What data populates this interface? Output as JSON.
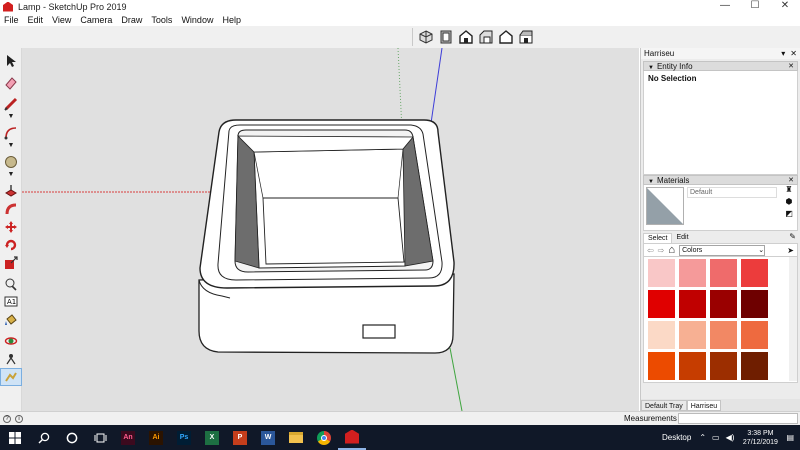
{
  "window": {
    "title": "Lamp - SketchUp Pro 2019",
    "controls": [
      "—",
      "☐",
      "✕"
    ]
  },
  "menu": [
    "File",
    "Edit",
    "View",
    "Camera",
    "Draw",
    "Tools",
    "Window",
    "Help"
  ],
  "view_toolbar": [
    "iso-view",
    "top-view",
    "front-view",
    "right-view",
    "back-view",
    "left-view"
  ],
  "left_tools": [
    "select",
    "eraser",
    "line",
    "arc",
    "circle",
    "push-pull",
    "follow-me",
    "move",
    "rotate",
    "scale",
    "tape-measure",
    "text",
    "paint-bucket",
    "orbit",
    "walk"
  ],
  "tray": {
    "title": "Harriseu",
    "controls": [
      "▾",
      "✕"
    ],
    "entity_info": {
      "header": "Entity Info",
      "value": "No Selection"
    },
    "materials": {
      "header": "Materials",
      "current_name": "Default",
      "tabs": [
        "Select",
        "Edit"
      ],
      "active_tab": "Select",
      "library": "Colors",
      "swatches": [
        "#f9c7c7",
        "#f59a9a",
        "#ef6b6b",
        "#ec3c3c",
        "#e00000",
        "#c00000",
        "#9a0000",
        "#6e0000",
        "#fbd9c6",
        "#f7b093",
        "#f28864",
        "#ee6a3f",
        "#ec4b00",
        "#c63d00",
        "#9c2e00",
        "#6f1e00",
        "#fde3c9",
        "#f9c49a",
        "#f5a66c",
        "#f08a44"
      ]
    },
    "bottom_tabs": [
      "Default Tray",
      "Harriseu"
    ],
    "active_bottom_tab": "Harriseu"
  },
  "status": {
    "measurements_label": "Measurements",
    "measurements_value": ""
  },
  "taskbar": {
    "apps": [
      {
        "name": "animate",
        "label": "An",
        "color": "#3c0a1e",
        "fg": "#ff5c8d"
      },
      {
        "name": "illustrator",
        "label": "Ai",
        "color": "#2b1300",
        "fg": "#ff9a00"
      },
      {
        "name": "photoshop",
        "label": "Ps",
        "color": "#001d34",
        "fg": "#31a8ff"
      },
      {
        "name": "excel",
        "label": "X",
        "color": "#1d6f42",
        "fg": "#ffffff"
      },
      {
        "name": "powerpoint",
        "label": "P",
        "color": "#c43e1c",
        "fg": "#ffffff"
      },
      {
        "name": "word",
        "label": "W",
        "color": "#2b579a",
        "fg": "#ffffff"
      },
      {
        "name": "file-explorer",
        "label": "",
        "color": "#f2c14e",
        "fg": "#ffffff"
      },
      {
        "name": "chrome",
        "label": "",
        "color": "#ffffff",
        "fg": "#ffffff"
      },
      {
        "name": "sketchup",
        "label": "",
        "color": "#d21f1f",
        "fg": "#ffffff"
      }
    ],
    "desktop_label": "Desktop",
    "time": "3:38 PM",
    "date": "27/12/2019"
  }
}
